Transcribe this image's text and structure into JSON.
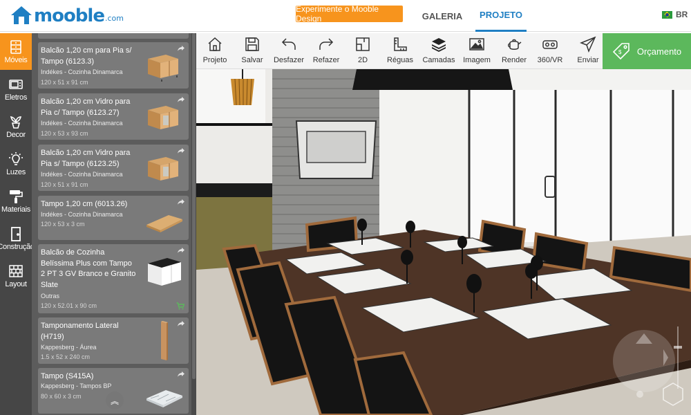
{
  "header": {
    "logo_text": "mooble",
    "logo_suffix": ".com",
    "promo_label": "Experimente o Mooble Design",
    "tabs": [
      {
        "label": "GALERIA",
        "active": false
      },
      {
        "label": "PROJETO",
        "active": true
      }
    ],
    "language": "BR"
  },
  "categories": [
    {
      "label": "Móveis",
      "icon": "cabinet-icon",
      "active": true
    },
    {
      "label": "Eletros",
      "icon": "microwave-icon",
      "active": false
    },
    {
      "label": "Decor",
      "icon": "plant-icon",
      "active": false
    },
    {
      "label": "Luzes",
      "icon": "lightbulb-icon",
      "active": false
    },
    {
      "label": "Materiais",
      "icon": "paint-roller-icon",
      "active": false
    },
    {
      "label": "Construção",
      "icon": "door-icon",
      "active": false
    },
    {
      "label": "Layout",
      "icon": "brick-wall-icon",
      "active": false
    }
  ],
  "catalog": {
    "items": [
      {
        "title": "Balcão 1,20 cm para Pia s/ Tampo (6123.3)",
        "brand": "Indékes - Cozinha Dinamarca",
        "dims": "120 x 51 x 91 cm"
      },
      {
        "title": "Balcão 1,20 cm Vidro para Pia c/ Tampo (6123.27)",
        "brand": "Indékes - Cozinha Dinamarca",
        "dims": "120 x 53 x 93 cm"
      },
      {
        "title": "Balcão 1,20 cm Vidro para Pia s/ Tampo (6123.25)",
        "brand": "Indékes - Cozinha Dinamarca",
        "dims": "120 x 51 x 91 cm"
      },
      {
        "title": "Tampo 1,20 cm (6013.26)",
        "brand": "Indékes - Cozinha Dinamarca",
        "dims": "120 x 53 x 3 cm"
      },
      {
        "title": "Balcão de Cozinha Belíssima Plus com Tampo 2 PT 3 GV Branco e Granito Slate",
        "brand": "Outras",
        "dims": "120 x 52.01 x 90 cm"
      },
      {
        "title": "Tamponamento Lateral (H719)",
        "brand": "Kappesberg - Áurea",
        "dims": "1.5 x 52 x 240 cm"
      },
      {
        "title": "Tampo (S415A)",
        "brand": "Kappesberg - Tampos BP",
        "dims": "80 x 60 x 3 cm"
      }
    ]
  },
  "toolbar": {
    "tools": [
      {
        "label": "Projeto",
        "icon": "home-icon"
      },
      {
        "label": "Salvar",
        "icon": "save-icon"
      },
      {
        "label": "Desfazer",
        "icon": "undo-icon"
      },
      {
        "label": "Refazer",
        "icon": "redo-icon"
      },
      {
        "label": "2D",
        "icon": "floorplan-2d-icon"
      },
      {
        "label": "Réguas",
        "icon": "ruler-icon"
      },
      {
        "label": "Camadas",
        "icon": "layers-icon"
      },
      {
        "label": "Imagem",
        "icon": "image-icon"
      },
      {
        "label": "Render",
        "icon": "teapot-icon"
      },
      {
        "label": "360/VR",
        "icon": "vr-headset-icon"
      },
      {
        "label": "Enviar",
        "icon": "send-icon"
      }
    ],
    "budget_label": "Orçamento",
    "budget_icon": "price-tag-icon"
  },
  "colors": {
    "brand_blue": "#1f7fc3",
    "accent_orange": "#f7941d",
    "budget_green": "#5cb85c",
    "sidebar_dark": "#464646",
    "catalog_bg": "#5c5c5c",
    "card_bg": "#7a7a7a"
  }
}
